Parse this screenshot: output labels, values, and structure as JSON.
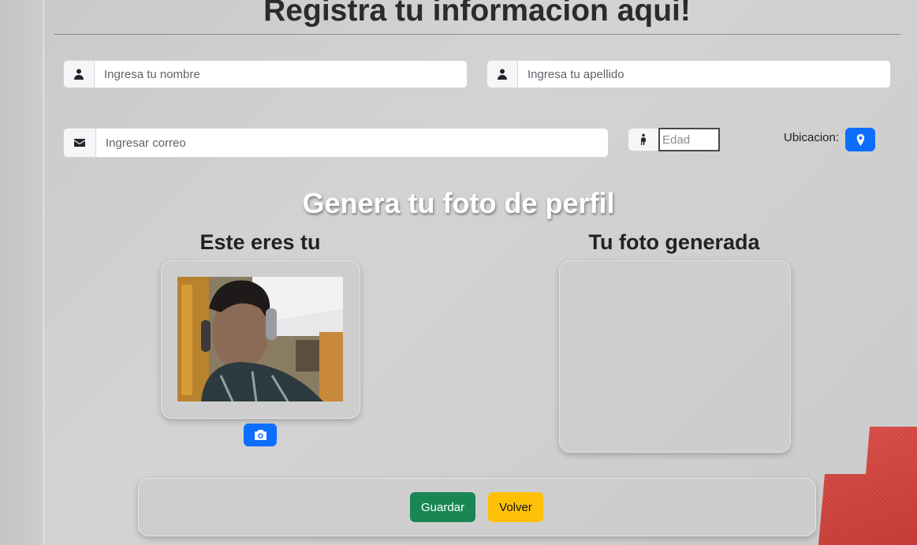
{
  "header": {
    "title": "Registra tu informacion aqui!"
  },
  "form": {
    "first_name": {
      "placeholder": "Ingresa tu nombre",
      "icon": "person-icon"
    },
    "last_name": {
      "placeholder": "Ingresa tu apellido",
      "icon": "person-icon"
    },
    "email": {
      "placeholder": "Ingresar correo",
      "icon": "envelope-icon"
    },
    "age": {
      "placeholder": "Edad",
      "icon": "person-standing-icon"
    },
    "location": {
      "label": "Ubicacion:",
      "icon": "geo-pin-icon"
    }
  },
  "profile": {
    "title": "Genera tu foto de perfil",
    "you_title": "Este eres tu",
    "generated_title": "Tu foto generada",
    "capture_icon": "camera-icon"
  },
  "actions": {
    "save_label": "Guardar",
    "back_label": "Volver"
  },
  "colors": {
    "primary": "#0d6efd",
    "success": "#198754",
    "warning": "#ffc107",
    "background": "#d0d0d1"
  }
}
